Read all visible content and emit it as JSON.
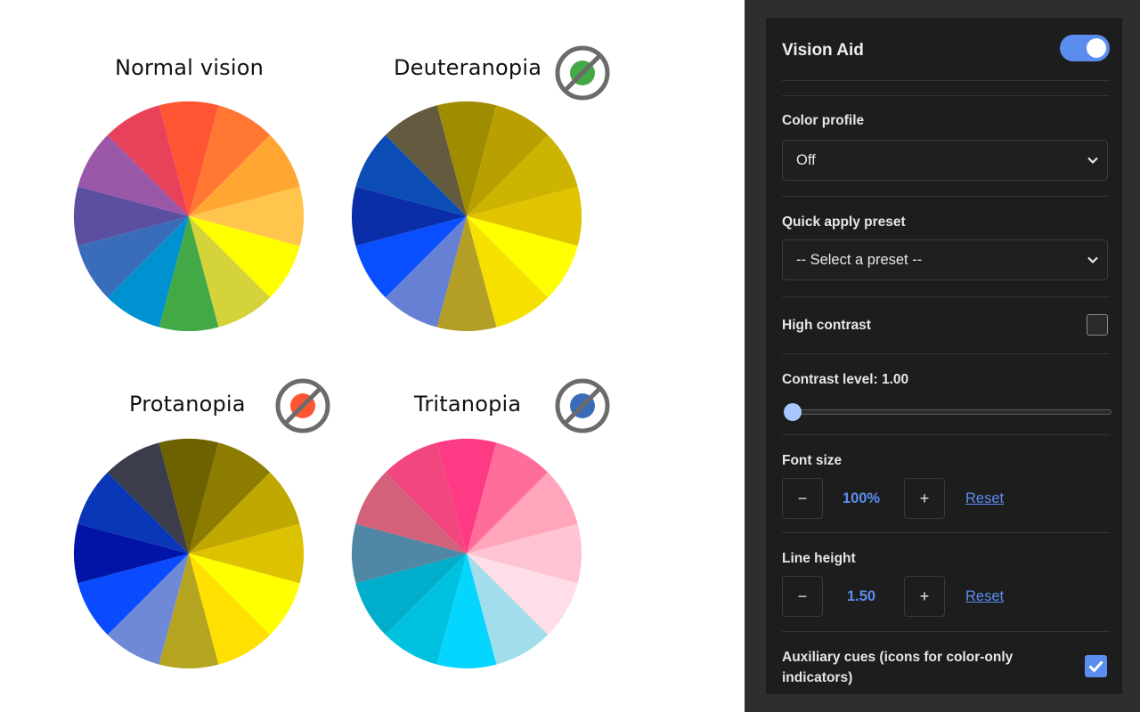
{
  "wheels": [
    {
      "title": "Normal vision",
      "badge": null,
      "colors": [
        "#ff5533",
        "#ff7733",
        "#ffa633",
        "#ffc54c",
        "#ffff00",
        "#d4d43a",
        "#43a946",
        "#0091d0",
        "#3a6db9",
        "#5a4fa0",
        "#9b57a8",
        "#e8425a"
      ]
    },
    {
      "title": "Deuteranopia",
      "badge": {
        "icon": "no-green-icon",
        "color": "#43a946"
      },
      "colors": [
        "#a08c00",
        "#b8a000",
        "#ccb400",
        "#e0c400",
        "#ffff00",
        "#f6e000",
        "#b39e27",
        "#6680d4",
        "#0a4fff",
        "#0a2ea8",
        "#0b4db5",
        "#645a3f"
      ]
    },
    {
      "title": "Protanopia",
      "badge": {
        "icon": "no-red-icon",
        "color": "#ff5533"
      },
      "colors": [
        "#6e6200",
        "#8c7c00",
        "#c0a800",
        "#dcc200",
        "#ffff00",
        "#ffe000",
        "#b5a420",
        "#7089d6",
        "#0b4bff",
        "#0014a8",
        "#0a36b8",
        "#3c3d4c"
      ]
    },
    {
      "title": "Tritanopia",
      "badge": {
        "icon": "no-blue-icon",
        "color": "#3a6db9"
      },
      "colors": [
        "#ff3a85",
        "#ff6e9b",
        "#ffa6bd",
        "#ffc4d2",
        "#ffdee8",
        "#a1ddeb",
        "#05d6ff",
        "#00c2e0",
        "#00aecc",
        "#4f87a4",
        "#d4617a",
        "#f2467e"
      ]
    }
  ],
  "panel": {
    "title": "Vision Aid",
    "enabled": true,
    "color_profile": {
      "label": "Color profile",
      "value": "Off"
    },
    "preset": {
      "label": "Quick apply preset",
      "placeholder": "-- Select a preset --"
    },
    "high_contrast": {
      "label": "High contrast",
      "checked": false
    },
    "contrast": {
      "label": "Contrast level: 1.00",
      "value": 1.0
    },
    "font_size": {
      "label": "Font size",
      "value": "100%",
      "minus": "−",
      "plus": "+",
      "reset": "Reset"
    },
    "line_height": {
      "label": "Line height",
      "value": "1.50",
      "minus": "−",
      "plus": "+",
      "reset": "Reset"
    },
    "aux": {
      "label_line1": "Auxiliary cues (icons for color-only",
      "label_line2": "indicators)",
      "checked": true
    },
    "colors": {
      "accent": "#5b8def",
      "panel_bg": "#1d1d1d"
    }
  }
}
